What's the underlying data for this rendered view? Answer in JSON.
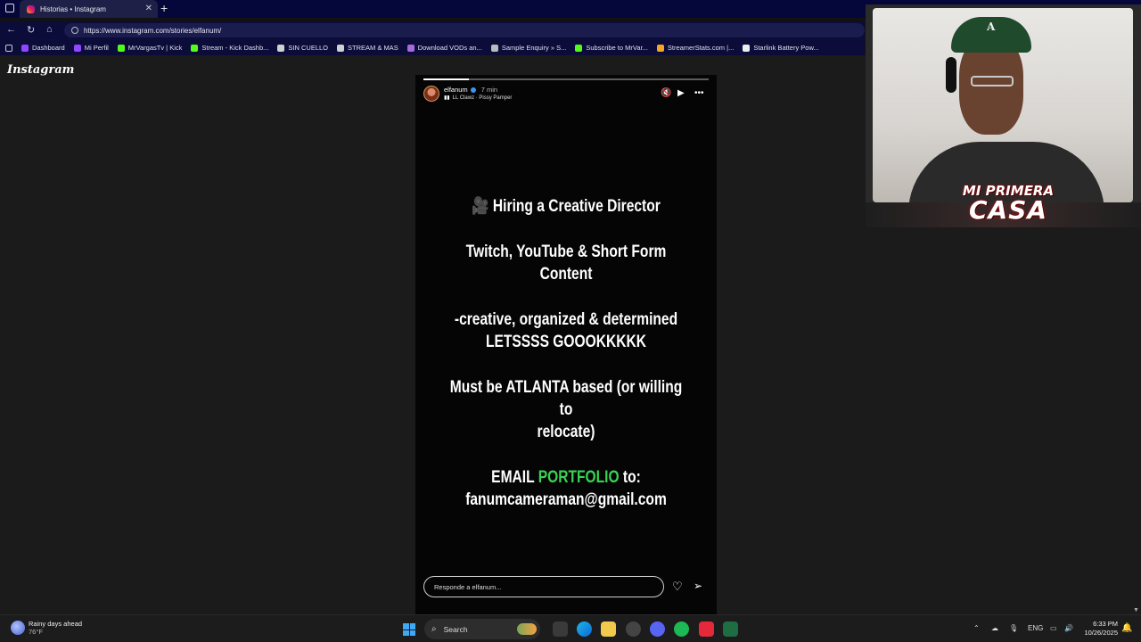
{
  "browser": {
    "tab_title": "Historias • Instagram",
    "tab_close": "✕",
    "new_tab": "+",
    "url": "https://www.instagram.com/stories/elfanum/",
    "bookmarks": [
      {
        "label": "Dashboard",
        "color": "#9146ff"
      },
      {
        "label": "Mi Perfil",
        "color": "#9146ff"
      },
      {
        "label": "MrVargasTv | Kick",
        "color": "#53fc18"
      },
      {
        "label": "Stream - Kick Dashb...",
        "color": "#53fc18"
      },
      {
        "label": "SIN CUELLO",
        "color": "#d0d0d0"
      },
      {
        "label": "STREAM & MAS",
        "color": "#d0d0d0"
      },
      {
        "label": "Download VODs an...",
        "color": "#a66bd8"
      },
      {
        "label": "Sample Enquiry » S...",
        "color": "#bbbbbb"
      },
      {
        "label": "Subscribe to MrVar...",
        "color": "#53fc18"
      },
      {
        "label": "StreamerStats.com |...",
        "color": "#f5a623"
      },
      {
        "label": "Starlink Battery Pow...",
        "color": "#eeeeee"
      }
    ]
  },
  "instagram": {
    "logo": "Instagram",
    "story": {
      "progress": 0.16,
      "username": "elfanum",
      "time": "7 min",
      "music": "LL Clawz · Pissy Pamper",
      "lines": {
        "title_emoji": "🎥",
        "title": "Hiring a Creative Director",
        "line2": "Twitch, YouTube & Short Form Content",
        "line3a": "-creative, organized & determined",
        "line3b": "LETSSSS GOOOKKKKK",
        "line4a": "Must be ATLANTA based (or willing to",
        "line4b": "relocate)",
        "email_prefix": "EMAIL",
        "email_highlight": "PORTFOLIO",
        "email_suffix": "to:",
        "email": "fanumcameraman@gmail.com"
      },
      "reply_placeholder": "Responde a elfanum..."
    }
  },
  "webcam": {
    "brand_top": "MI PRIMERA",
    "brand_bottom": "CASA",
    "cap_letter": "A"
  },
  "taskbar": {
    "weather_title": "Rainy days ahead",
    "weather_temp": "76°F",
    "search_label": "Search",
    "lang": "ENG",
    "time": "6:33 PM",
    "date": "10/26/2025"
  },
  "colors": {
    "accent_green": "#39d353",
    "chrome_bg": "#0b0c3a"
  }
}
